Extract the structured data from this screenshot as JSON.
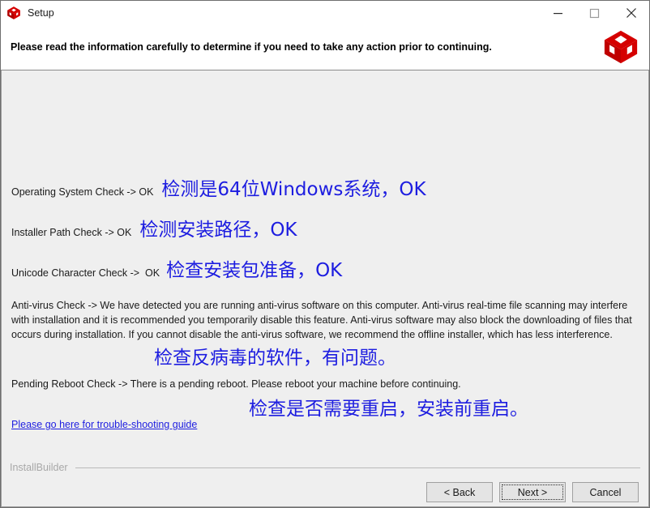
{
  "window": {
    "title": "Setup",
    "icon": "red-cube-icon",
    "accent_red": "#d50000",
    "annotation_blue": "#1d1de0",
    "body_bg": "#efefef",
    "controls": {
      "minimize": "minimize-icon",
      "maximize": "maximize-icon",
      "close": "close-icon"
    }
  },
  "header": {
    "instruction": "Please read the information carefully to determine if you need to take any action prior to continuing.",
    "logo": "red-cube-logo"
  },
  "checks": [
    {
      "label": "Operating System Check -> OK",
      "annotation": "检测是64位Windows系统，OK"
    },
    {
      "label": "Installer Path Check -> OK",
      "annotation": "检测安装路径，OK"
    },
    {
      "label": "Unicode Character Check ->  OK",
      "annotation": "检查安装包准备，OK"
    }
  ],
  "antivirus": {
    "text": "Anti-virus Check -> We have detected you are running anti-virus software on this computer. Anti-virus real-time file scanning may interfere with installation and it is recommended you temporarily disable this feature. Anti-virus software may also block the downloading of files that occurs during installation. If you cannot disable the anti-virus software, we recommend the offline installer, which has less interference.",
    "annotation": "检查反病毒的软件，有问题。"
  },
  "reboot": {
    "text": "Pending Reboot Check -> There is a pending reboot. Please reboot your machine before continuing.",
    "annotation": "检查是否需要重启，安装前重启。"
  },
  "link": {
    "label": "Please go here for trouble-shooting guide"
  },
  "footer": {
    "brand": "InstallBuilder",
    "buttons": {
      "back": "< Back",
      "next": "Next >",
      "cancel": "Cancel"
    }
  }
}
